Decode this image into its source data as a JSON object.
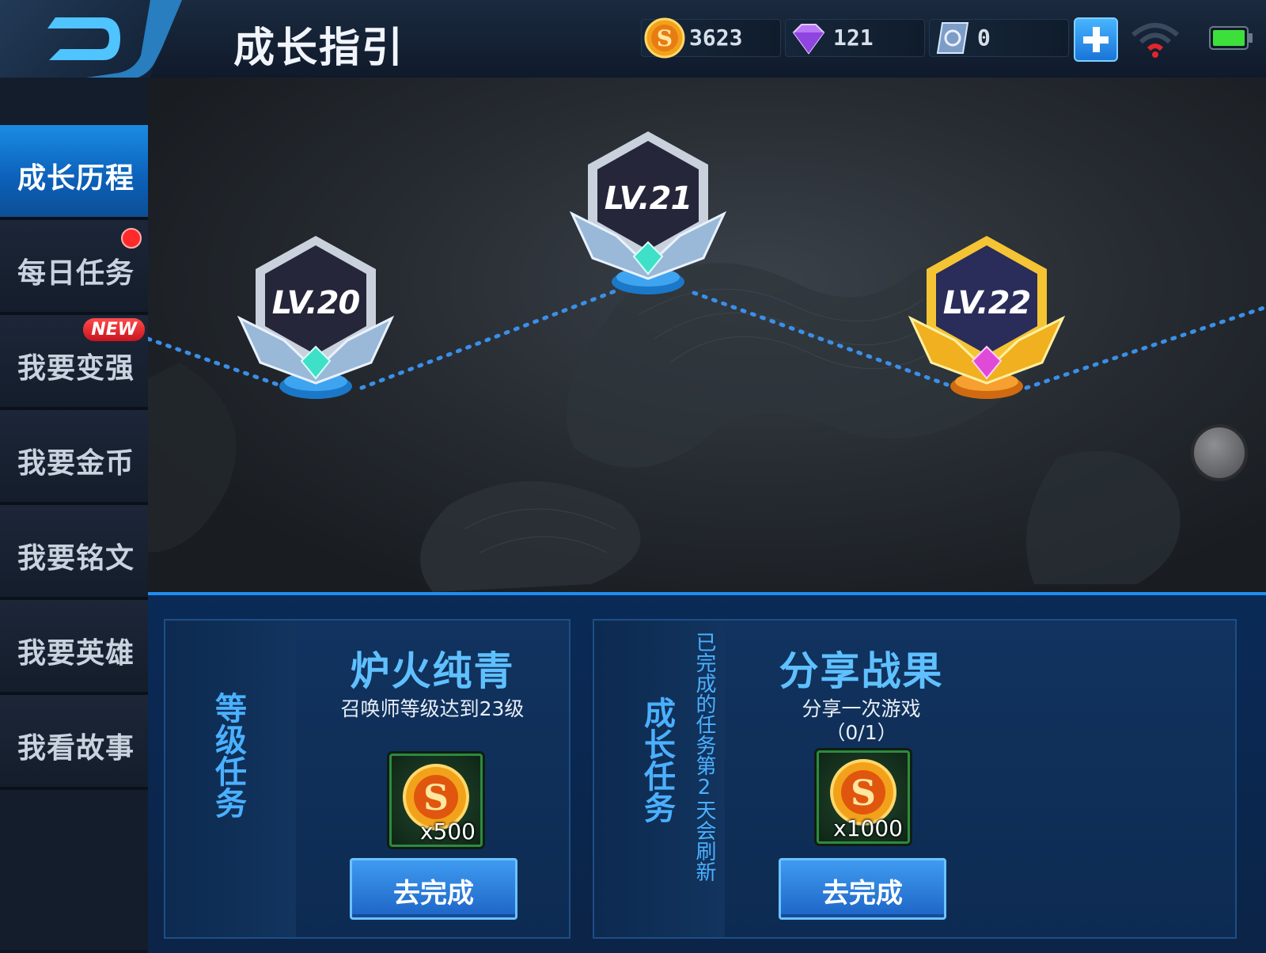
{
  "header": {
    "title": "成长指引",
    "currencies": [
      {
        "icon": "gold-coin-icon",
        "value": "3623"
      },
      {
        "icon": "diamond-icon",
        "value": "121"
      },
      {
        "icon": "voucher-icon",
        "value": "0"
      }
    ]
  },
  "sidebar": {
    "items": [
      {
        "label": "成长历程",
        "active": true
      },
      {
        "label": "每日任务",
        "red_dot": true
      },
      {
        "label": "我要变强",
        "badge": "NEW"
      },
      {
        "label": "我要金币"
      },
      {
        "label": "我要铭文"
      },
      {
        "label": "我要英雄"
      },
      {
        "label": "我看故事"
      }
    ]
  },
  "map": {
    "levels": [
      {
        "label": "LV.20",
        "tier": "silver"
      },
      {
        "label": "LV.21",
        "tier": "silver"
      },
      {
        "label": "LV.22",
        "tier": "gold"
      }
    ]
  },
  "level_task": {
    "section_label": "等级任务",
    "name": "炉火纯青",
    "description": "召唤师等级达到23级",
    "reward_qty": "x500",
    "button": "去完成"
  },
  "growth_task": {
    "section_label": "成长任务",
    "refresh_note": "已完成的任务第2天会刷新",
    "name": "分享战果",
    "description": "分享一次游戏",
    "progress": "（0/1）",
    "reward_qty": "x1000",
    "button": "去完成"
  },
  "colors": {
    "accent_blue": "#1a8ce4",
    "task_title": "#5fc0ff",
    "gold": "#f5b820",
    "alert_red": "#ff2a2a"
  }
}
